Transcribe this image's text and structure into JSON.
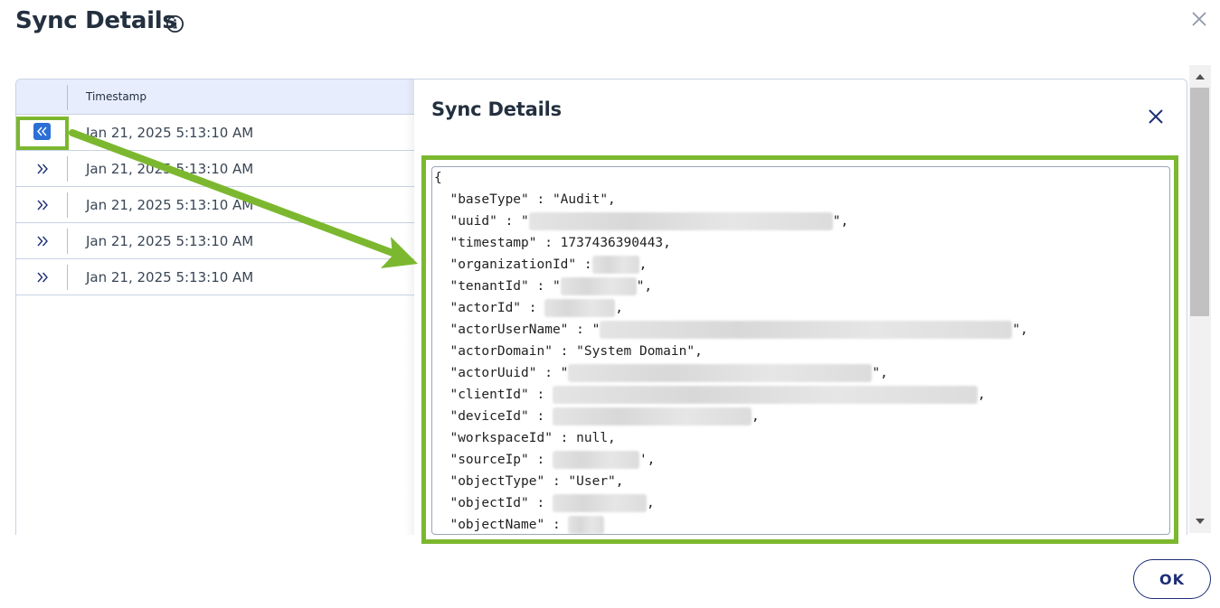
{
  "dialog": {
    "title": "Sync Details",
    "ok_label": "OK"
  },
  "table": {
    "columns": [
      "Timestamp"
    ],
    "rows": [
      {
        "timestamp": "Jan 21, 2025 5:13:10 AM",
        "expanded": true
      },
      {
        "timestamp": "Jan 21, 2025 5:13:10 AM",
        "expanded": false
      },
      {
        "timestamp": "Jan 21, 2025 5:13:10 AM",
        "expanded": false
      },
      {
        "timestamp": "Jan 21, 2025 5:13:10 AM",
        "expanded": false
      },
      {
        "timestamp": "Jan 21, 2025 5:13:10 AM",
        "expanded": false
      }
    ]
  },
  "detail_panel": {
    "title": "Sync Details",
    "json_lines": [
      {
        "prefix": "{",
        "redacted": false,
        "suffix": ""
      },
      {
        "prefix": "  \"baseType\" : \"Audit\",",
        "redacted": false,
        "suffix": ""
      },
      {
        "prefix": "  \"uuid\" : \"",
        "redacted": true,
        "suffix": "\","
      },
      {
        "prefix": "  \"timestamp\" : 1737436390443,",
        "redacted": false,
        "suffix": ""
      },
      {
        "prefix": "  \"organizationId\" :",
        "redacted": true,
        "suffix": ","
      },
      {
        "prefix": "  \"tenantId\" : \"",
        "redacted": true,
        "suffix": "\","
      },
      {
        "prefix": "  \"actorId\" : ",
        "redacted": true,
        "suffix": ","
      },
      {
        "prefix": "  \"actorUserName\" : \"",
        "redacted": true,
        "suffix": "\","
      },
      {
        "prefix": "  \"actorDomain\" : \"System Domain\",",
        "redacted": false,
        "suffix": ""
      },
      {
        "prefix": "  \"actorUuid\" : \"",
        "redacted": true,
        "suffix": "\","
      },
      {
        "prefix": "  \"clientId\" : ",
        "redacted": true,
        "suffix": ","
      },
      {
        "prefix": "  \"deviceId\" : ",
        "redacted": true,
        "suffix": ","
      },
      {
        "prefix": "  \"workspaceId\" : null,",
        "redacted": false,
        "suffix": ""
      },
      {
        "prefix": "  \"sourceIp\" : ",
        "redacted": true,
        "suffix": "',"
      },
      {
        "prefix": "  \"objectType\" : \"User\",",
        "redacted": false,
        "suffix": ""
      },
      {
        "prefix": "  \"objectId\" : ",
        "redacted": true,
        "suffix": ","
      },
      {
        "prefix": "  \"objectName\" : ",
        "redacted": true,
        "suffix": ""
      }
    ]
  },
  "icons": {
    "info": "info-icon",
    "close": "close-icon",
    "expand": "chevron-double-right-icon",
    "collapse": "chevron-double-left-icon"
  },
  "colors": {
    "highlight": "#7cb82f",
    "accent": "#2c6fd6",
    "header_bg": "#e7edfc",
    "ok_border": "#1d2e75"
  }
}
